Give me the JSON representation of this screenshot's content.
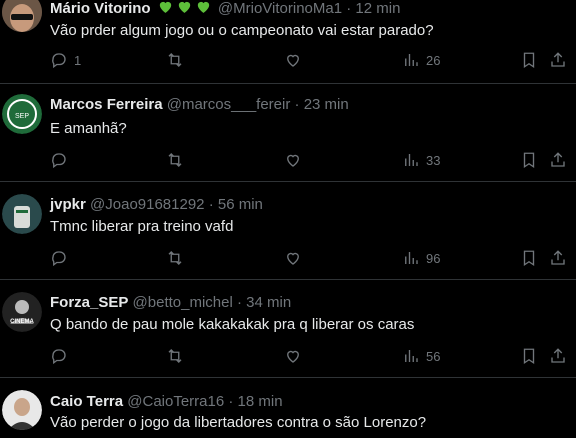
{
  "tweets": [
    {
      "name": "Mário Vitorino",
      "handle": "@MrioVitorinoMa1",
      "sep": "·",
      "time": "12 min",
      "text": "Vão prder algum jogo ou o campeonato vai estar parado?",
      "replies": "1",
      "retweets": "",
      "likes": "",
      "views": "26",
      "has_hearts": true
    },
    {
      "name": "Marcos Ferreira",
      "handle": "@marcos___fereir",
      "sep": "·",
      "time": "23 min",
      "text": "E amanhã?",
      "replies": "",
      "retweets": "",
      "likes": "",
      "views": "33"
    },
    {
      "name": "jvpkr",
      "handle": "@Joao91681292",
      "sep": "·",
      "time": "56 min",
      "text": "Tmnc liberar pra treino vafd",
      "replies": "",
      "retweets": "",
      "likes": "",
      "views": "96"
    },
    {
      "name": "Forza_SEP",
      "handle": "@betto_michel",
      "sep": "·",
      "time": "34 min",
      "text": "Q bando de pau mole kakakakak pra q liberar os caras",
      "replies": "",
      "retweets": "",
      "likes": "",
      "views": "56",
      "avatar_label": "CINEMA"
    },
    {
      "name": "Caio Terra",
      "handle": "@CaioTerra16",
      "sep": "·",
      "time": "18 min",
      "text": "Vão perder o jogo da libertadores contra o são Lorenzo?"
    }
  ],
  "colors": {
    "name": "#e7e9ea",
    "meta": "#71767b",
    "divider": "#2f3336",
    "heart_green": "#5dbf3a"
  }
}
